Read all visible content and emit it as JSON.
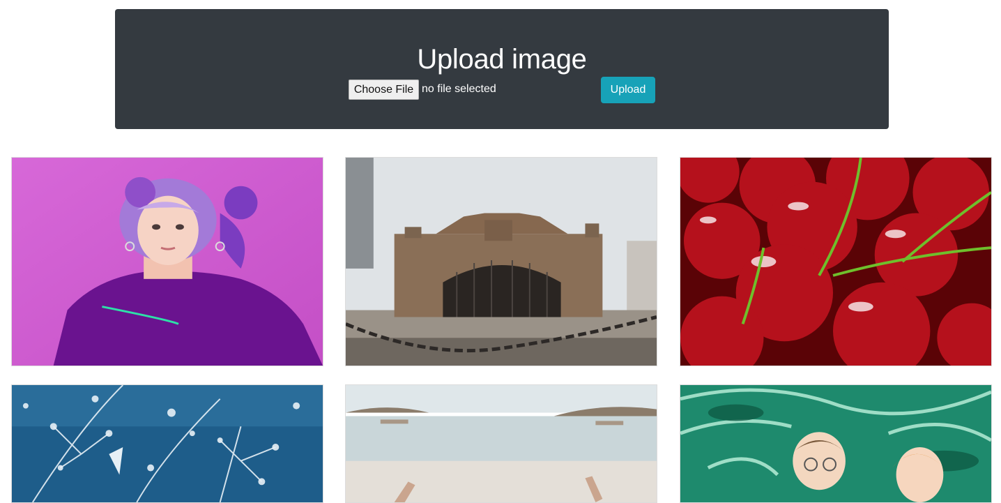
{
  "header": {
    "title": "Upload image",
    "file_button_label": "Choose File",
    "file_status": "no file selected",
    "upload_label": "Upload"
  },
  "gallery": {
    "images": [
      {
        "subject": "girl-purple-hair"
      },
      {
        "subject": "stone-gate-chapel"
      },
      {
        "subject": "cherries"
      },
      {
        "subject": "blue-cyanotype-flowers"
      },
      {
        "subject": "beach-arms-raised"
      },
      {
        "subject": "anime-characters-water"
      }
    ]
  },
  "colors": {
    "header_bg": "#343a40",
    "upload_button": "#17a2b8"
  }
}
